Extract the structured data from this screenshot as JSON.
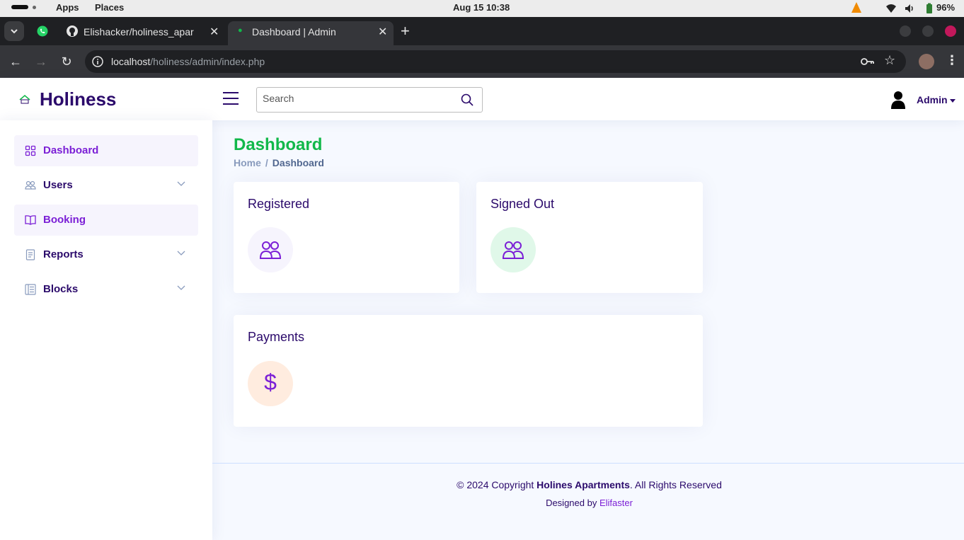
{
  "system_bar": {
    "apps": "Apps",
    "places": "Places",
    "clock": "Aug 15  10:38",
    "battery": "96%"
  },
  "browser": {
    "tabs": [
      {
        "title": "Elishacker/holiness_apar",
        "icon": "github-icon"
      },
      {
        "title": "Dashboard | Admin",
        "icon": "site-favicon"
      }
    ],
    "url_host": "localhost",
    "url_path": "/holiness/admin/index.php"
  },
  "header": {
    "logo_text": "Holiness",
    "search_placeholder": "Search",
    "user_name": "Admin"
  },
  "sidebar": {
    "items": [
      {
        "label": "Dashboard",
        "icon": "grid-icon"
      },
      {
        "label": "Users",
        "icon": "people-icon"
      },
      {
        "label": "Booking",
        "icon": "book-icon"
      },
      {
        "label": "Reports",
        "icon": "journal-icon"
      },
      {
        "label": "Blocks",
        "icon": "layout-icon"
      }
    ]
  },
  "main": {
    "page_title": "Dashboard",
    "breadcrumb": {
      "home": "Home",
      "separator": "/",
      "current": "Dashboard"
    },
    "cards": [
      {
        "title": "Registered",
        "icon": "people-icon",
        "icon_bg": "#f6f4fd"
      },
      {
        "title": "Signed Out",
        "icon": "people-icon",
        "icon_bg": "#e0f8e9"
      },
      {
        "title": "Payments",
        "icon": "dollar-icon",
        "icon_bg": "#ffecdf",
        "symbol": "$"
      }
    ]
  },
  "footer": {
    "copyright_prefix": "© 2024 Copyright ",
    "company": "Holines Apartments",
    "copyright_suffix": ". All Rights Reserved",
    "designed_by": "Designed by ",
    "designer": "Elifaster"
  },
  "colors": {
    "accent": "#7b1fd6",
    "title_green": "#11b84a",
    "dark_navy": "#2b0a6b"
  }
}
